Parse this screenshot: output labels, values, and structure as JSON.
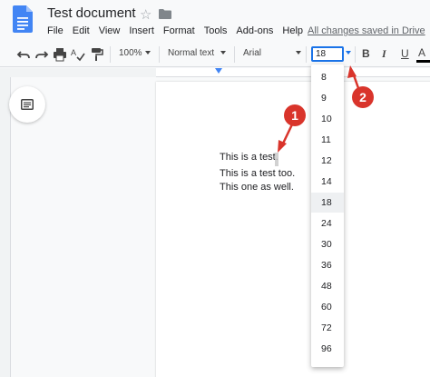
{
  "app": {
    "title": "Test document",
    "save_status": "All changes saved in Drive"
  },
  "menu": [
    "File",
    "Edit",
    "View",
    "Insert",
    "Format",
    "Tools",
    "Add-ons",
    "Help"
  ],
  "toolbar": {
    "zoom": "100%",
    "style": "Normal text",
    "font": "Arial",
    "font_size": "18",
    "bold": "B",
    "italic": "I",
    "underline": "U",
    "text_color": "A"
  },
  "document": {
    "lines": [
      "This is a test.",
      "This is a test too.",
      "This one as well."
    ]
  },
  "font_size_menu": {
    "options": [
      "8",
      "9",
      "10",
      "11",
      "12",
      "14",
      "18",
      "24",
      "30",
      "36",
      "48",
      "60",
      "72",
      "96"
    ],
    "selected": "18"
  },
  "annotations": {
    "badge1": "1",
    "badge2": "2",
    "color": "#d9342b"
  },
  "icons": [
    "docs-logo-icon",
    "star-icon",
    "folder-icon",
    "undo-icon",
    "redo-icon",
    "print-icon",
    "spellcheck-icon",
    "paint-format-icon",
    "outline-icon"
  ],
  "colors": {
    "accent": "#1a73e8",
    "docs_blue": "#4285f4"
  }
}
